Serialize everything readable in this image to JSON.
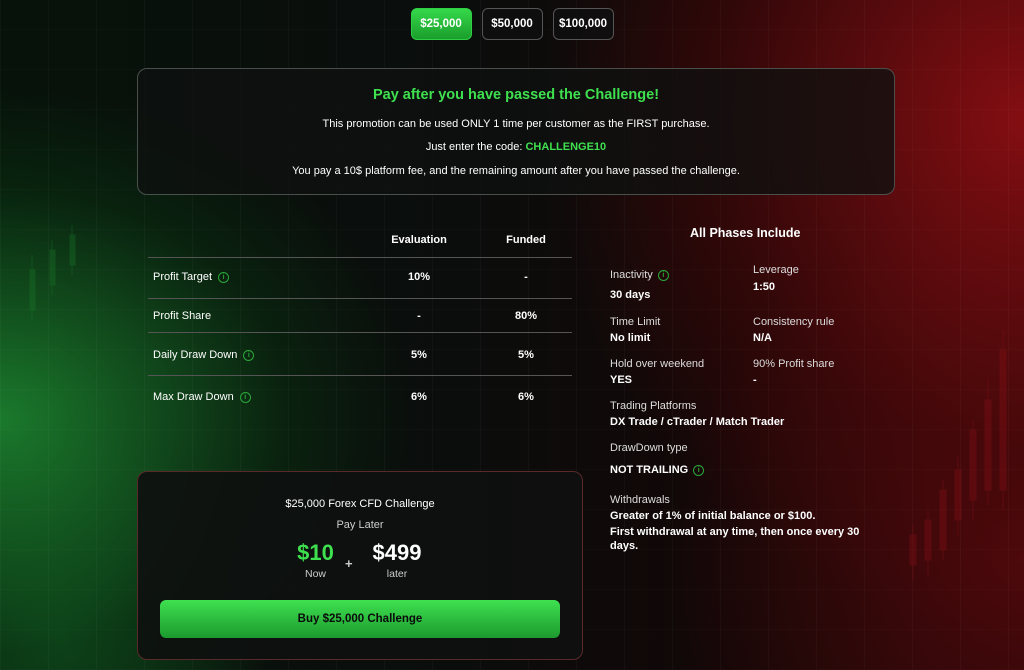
{
  "tabs": [
    "$25,000",
    "$50,000",
    "$100,000"
  ],
  "promo": {
    "title": "Pay after you have passed the Challenge!",
    "line1": "This promotion can be used ONLY 1 time per customer as the FIRST purchase.",
    "line2_prefix": "Just enter the code: ",
    "code": "CHALLENGE10",
    "line3": "You pay a 10$ platform fee, and the remaining amount after you have passed the challenge."
  },
  "table": {
    "headers": [
      "Evaluation",
      "Funded"
    ],
    "rows": [
      {
        "label": "Profit Target",
        "evaluation": "10%",
        "funded": "-"
      },
      {
        "label": "Profit Share",
        "evaluation": "-",
        "funded": "80%"
      },
      {
        "label": "Daily Draw Down",
        "evaluation": "5%",
        "funded": "5%"
      },
      {
        "label": "Max Draw Down",
        "evaluation": "6%",
        "funded": "6%"
      }
    ]
  },
  "phases": {
    "title": "All Phases Include",
    "inactivity": {
      "label": "Inactivity",
      "value": "30 days"
    },
    "leverage": {
      "label": "Leverage",
      "value": "1:50"
    },
    "time_limit": {
      "label": "Time Limit",
      "value": "No limit"
    },
    "consistency": {
      "label": "Consistency rule",
      "value": "N/A"
    },
    "weekend": {
      "label": "Hold over weekend",
      "value": "YES"
    },
    "profit_share": {
      "label": "90% Profit share",
      "value": "-"
    },
    "platforms": {
      "label": "Trading Platforms",
      "value": "DX Trade / cTrader / Match Trader"
    },
    "drawdown_type": {
      "label": "DrawDown type",
      "value": "NOT TRAILING"
    },
    "withdrawals": {
      "label": "Withdrawals",
      "line1": "Greater of 1% of initial balance or $100.",
      "line2": "First withdrawal at any time, then once every 30",
      "line3": "days."
    }
  },
  "card": {
    "title": "$25,000 Forex CFD Challenge",
    "subtitle": "Pay Later",
    "now_amount": "$10",
    "now_label": "Now",
    "plus": "+",
    "later_amount": "$499",
    "later_label": "later",
    "buy_label": "Buy $25,000 Challenge"
  },
  "colors": {
    "accent_green": "#3fe04f",
    "background": "#0b0d0c"
  }
}
